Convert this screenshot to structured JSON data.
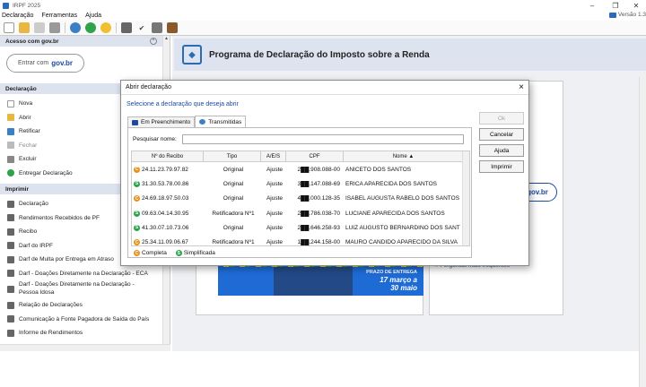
{
  "window": {
    "title": "IRPF 2025",
    "version": "Versão 1.3"
  },
  "menu": [
    "Declaração",
    "Ferramentas",
    "Ajuda"
  ],
  "toolbar_icons": [
    "new-file-icon",
    "open-folder-icon",
    "save-icon",
    "trash-icon",
    "globe-icon",
    "recycle-icon",
    "govbr-icon",
    "print-icon",
    "check-icon",
    "document-icon",
    "book-icon"
  ],
  "sidebar": {
    "access_header": "Acesso com gov.br",
    "govbr_label": "Entrar com",
    "govbr_brand": "gov.br",
    "declaracao_header": "Declaração",
    "declaracao_items": [
      "Nova",
      "Abrir",
      "Retificar",
      "Fechar",
      "Excluir",
      "Entregar Declaração"
    ],
    "imprimir_header": "Imprimir",
    "imprimir_items": [
      "Declaração",
      "Rendimentos Recebidos de PF",
      "Recibo",
      "Darf do IRPF",
      "Darf de Multa por Entrega em Atraso",
      "Darf - Doações Diretamente na Declaração - ECA",
      "Darf - Doações Diretamente na Declaração -",
      "Pessoa Idosa",
      "Relação de Declarações",
      "Comunicação à Fonte Pagadora de Saída do País",
      "Informe de Rendimentos"
    ]
  },
  "main": {
    "banner_title": "Programa de Declaração do Imposto sobre a Renda",
    "govbr_button": "gov.br",
    "faq_link": "Perguntas mais frequentes",
    "promo_line1": "PRAZO DE ENTREGA",
    "promo_line2": "17 março a",
    "promo_line3": "30 maio"
  },
  "dialog": {
    "title": "Abrir declaração",
    "prompt": "Selecione a declaração que deseja abrir",
    "tabs": [
      "Em Preenchimento",
      "Transmitidas"
    ],
    "search_label": "Pesquisar nome:",
    "search_value": "",
    "columns": [
      "Nº do Recibo",
      "Tipo",
      "A/E/S",
      "CPF",
      "Nome ▲"
    ],
    "rows": [
      {
        "recibo": "24.11.23.79.97.82",
        "tipo": "Original",
        "aes": "Ajuste",
        "cpf": "2██.908.088-00",
        "nome": "ANICETO DOS SANTOS",
        "badge": "C"
      },
      {
        "recibo": "31.30.53.78.00.86",
        "tipo": "Original",
        "aes": "Ajuste",
        "cpf": "3██.147.088-69",
        "nome": "ERICA APARECIDA DOS SANTOS",
        "badge": "S"
      },
      {
        "recibo": "24.69.18.97.50.03",
        "tipo": "Original",
        "aes": "Ajuste",
        "cpf": "4██.000.128-35",
        "nome": "ISABEL AUGUSTA RABELO DOS SANTOS",
        "badge": "C"
      },
      {
        "recibo": "09.63.04.14.30.95",
        "tipo": "Retificadora Nº1",
        "aes": "Ajuste",
        "cpf": "2██.786.038-70",
        "nome": "LUCIANE APARECIDA DOS SANTOS",
        "badge": "S"
      },
      {
        "recibo": "41.30.07.10.73.06",
        "tipo": "Original",
        "aes": "Ajuste",
        "cpf": "2██.646.258-93",
        "nome": "LUIZ AUGUSTO BERNARDINO DOS SANT",
        "badge": "S"
      },
      {
        "recibo": "25.34.11.09.06.67",
        "tipo": "Retificadora Nº1",
        "aes": "Ajuste",
        "cpf": "1██.244.158-00",
        "nome": "MAURO CANDIDO APARECIDO DA SILVA",
        "badge": "C"
      }
    ],
    "legend": [
      {
        "letter": "C",
        "label": "Completa"
      },
      {
        "letter": "S",
        "label": "Simplificada"
      }
    ],
    "buttons": {
      "ok": "Ok",
      "cancel": "Cancelar",
      "help": "Ajuda",
      "print": "Imprimir"
    }
  },
  "colors": {
    "completa": "#e8901a",
    "simplificada": "#2da34a",
    "link": "#1b4aa0",
    "header_bg": "#dde3ee"
  }
}
